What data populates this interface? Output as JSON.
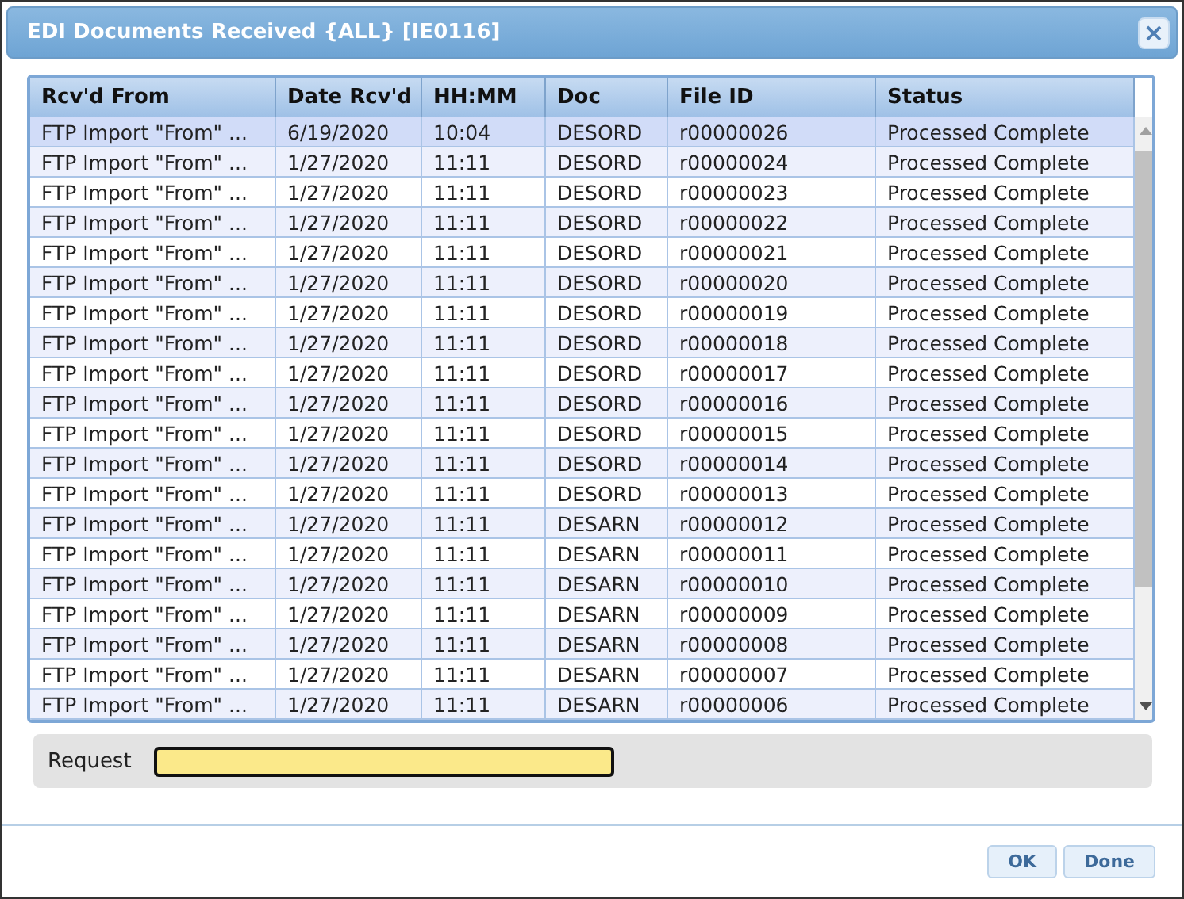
{
  "window": {
    "title": "EDI Documents Received {ALL} [IE0116]",
    "close": "×"
  },
  "table": {
    "columns": [
      "Rcv'd From",
      "Date Rcv'd",
      "HH:MM",
      "Doc",
      "File ID",
      "Status"
    ],
    "rows": [
      {
        "selected": true,
        "cells": [
          "FTP Import \"From\" ...",
          "6/19/2020",
          "10:04",
          "DESORD",
          "r00000026",
          "Processed Complete"
        ]
      },
      {
        "selected": false,
        "cells": [
          "FTP Import \"From\" ...",
          "1/27/2020",
          "11:11",
          "DESORD",
          "r00000024",
          "Processed Complete"
        ]
      },
      {
        "selected": false,
        "cells": [
          "FTP Import \"From\" ...",
          "1/27/2020",
          "11:11",
          "DESORD",
          "r00000023",
          "Processed Complete"
        ]
      },
      {
        "selected": false,
        "cells": [
          "FTP Import \"From\" ...",
          "1/27/2020",
          "11:11",
          "DESORD",
          "r00000022",
          "Processed Complete"
        ]
      },
      {
        "selected": false,
        "cells": [
          "FTP Import \"From\" ...",
          "1/27/2020",
          "11:11",
          "DESORD",
          "r00000021",
          "Processed Complete"
        ]
      },
      {
        "selected": false,
        "cells": [
          "FTP Import \"From\" ...",
          "1/27/2020",
          "11:11",
          "DESORD",
          "r00000020",
          "Processed Complete"
        ]
      },
      {
        "selected": false,
        "cells": [
          "FTP Import \"From\" ...",
          "1/27/2020",
          "11:11",
          "DESORD",
          "r00000019",
          "Processed Complete"
        ]
      },
      {
        "selected": false,
        "cells": [
          "FTP Import \"From\" ...",
          "1/27/2020",
          "11:11",
          "DESORD",
          "r00000018",
          "Processed Complete"
        ]
      },
      {
        "selected": false,
        "cells": [
          "FTP Import \"From\" ...",
          "1/27/2020",
          "11:11",
          "DESORD",
          "r00000017",
          "Processed Complete"
        ]
      },
      {
        "selected": false,
        "cells": [
          "FTP Import \"From\" ...",
          "1/27/2020",
          "11:11",
          "DESORD",
          "r00000016",
          "Processed Complete"
        ]
      },
      {
        "selected": false,
        "cells": [
          "FTP Import \"From\" ...",
          "1/27/2020",
          "11:11",
          "DESORD",
          "r00000015",
          "Processed Complete"
        ]
      },
      {
        "selected": false,
        "cells": [
          "FTP Import \"From\" ...",
          "1/27/2020",
          "11:11",
          "DESORD",
          "r00000014",
          "Processed Complete"
        ]
      },
      {
        "selected": false,
        "cells": [
          "FTP Import \"From\" ...",
          "1/27/2020",
          "11:11",
          "DESORD",
          "r00000013",
          "Processed Complete"
        ]
      },
      {
        "selected": false,
        "cells": [
          "FTP Import \"From\" ...",
          "1/27/2020",
          "11:11",
          "DESARN",
          "r00000012",
          "Processed Complete"
        ]
      },
      {
        "selected": false,
        "cells": [
          "FTP Import \"From\" ...",
          "1/27/2020",
          "11:11",
          "DESARN",
          "r00000011",
          "Processed Complete"
        ]
      },
      {
        "selected": false,
        "cells": [
          "FTP Import \"From\" ...",
          "1/27/2020",
          "11:11",
          "DESARN",
          "r00000010",
          "Processed Complete"
        ]
      },
      {
        "selected": false,
        "cells": [
          "FTP Import \"From\" ...",
          "1/27/2020",
          "11:11",
          "DESARN",
          "r00000009",
          "Processed Complete"
        ]
      },
      {
        "selected": false,
        "cells": [
          "FTP Import \"From\" ...",
          "1/27/2020",
          "11:11",
          "DESARN",
          "r00000008",
          "Processed Complete"
        ]
      },
      {
        "selected": false,
        "cells": [
          "FTP Import \"From\" ...",
          "1/27/2020",
          "11:11",
          "DESARN",
          "r00000007",
          "Processed Complete"
        ]
      },
      {
        "selected": false,
        "cells": [
          "FTP Import \"From\" ...",
          "1/27/2020",
          "11:11",
          "DESARN",
          "r00000006",
          "Processed Complete"
        ]
      }
    ]
  },
  "request": {
    "label": "Request"
  },
  "buttons": [
    "OK",
    "Done"
  ]
}
